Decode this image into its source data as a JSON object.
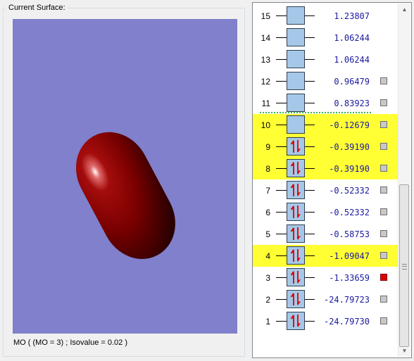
{
  "surface_panel": {
    "title": "Current Surface:",
    "status": "MO ( (MO = 3) ; Isovalue = 0.02 )",
    "background_color": "#8080cc",
    "surface_color": "#8b0000"
  },
  "mo_list": {
    "rows": [
      {
        "num": "15",
        "energy": "1.23807",
        "occupied": false,
        "highlighted": false,
        "marker": false,
        "selected": false
      },
      {
        "num": "14",
        "energy": "1.06244",
        "occupied": false,
        "highlighted": false,
        "marker": false,
        "selected": false
      },
      {
        "num": "13",
        "energy": "1.06244",
        "occupied": false,
        "highlighted": false,
        "marker": false,
        "selected": false
      },
      {
        "num": "12",
        "energy": "0.96479",
        "occupied": false,
        "highlighted": false,
        "marker": true,
        "selected": false
      },
      {
        "num": "11",
        "energy": "0.83923",
        "occupied": false,
        "highlighted": false,
        "marker": true,
        "selected": false
      },
      {
        "num": "10",
        "energy": "-0.12679",
        "occupied": false,
        "highlighted": true,
        "marker": true,
        "selected": false
      },
      {
        "num": "9",
        "energy": "-0.39190",
        "occupied": true,
        "highlighted": true,
        "marker": true,
        "selected": false
      },
      {
        "num": "8",
        "energy": "-0.39190",
        "occupied": true,
        "highlighted": true,
        "marker": true,
        "selected": false
      },
      {
        "num": "7",
        "energy": "-0.52332",
        "occupied": true,
        "highlighted": false,
        "marker": true,
        "selected": false
      },
      {
        "num": "6",
        "energy": "-0.52332",
        "occupied": true,
        "highlighted": false,
        "marker": true,
        "selected": false
      },
      {
        "num": "5",
        "energy": "-0.58753",
        "occupied": true,
        "highlighted": false,
        "marker": true,
        "selected": false
      },
      {
        "num": "4",
        "energy": "-1.09047",
        "occupied": true,
        "highlighted": true,
        "marker": true,
        "selected": false
      },
      {
        "num": "3",
        "energy": "-1.33659",
        "occupied": true,
        "highlighted": false,
        "marker": true,
        "selected": true
      },
      {
        "num": "2",
        "energy": "-24.79723",
        "occupied": true,
        "highlighted": false,
        "marker": true,
        "selected": false
      },
      {
        "num": "1",
        "energy": "-24.79730",
        "occupied": true,
        "highlighted": false,
        "marker": true,
        "selected": false
      }
    ],
    "highlight_color": "#ffff33",
    "selected_marker_color": "#e00000"
  },
  "scrollbar": {
    "up_icon": "scroll-up-arrow",
    "down_icon": "scroll-down-arrow"
  }
}
